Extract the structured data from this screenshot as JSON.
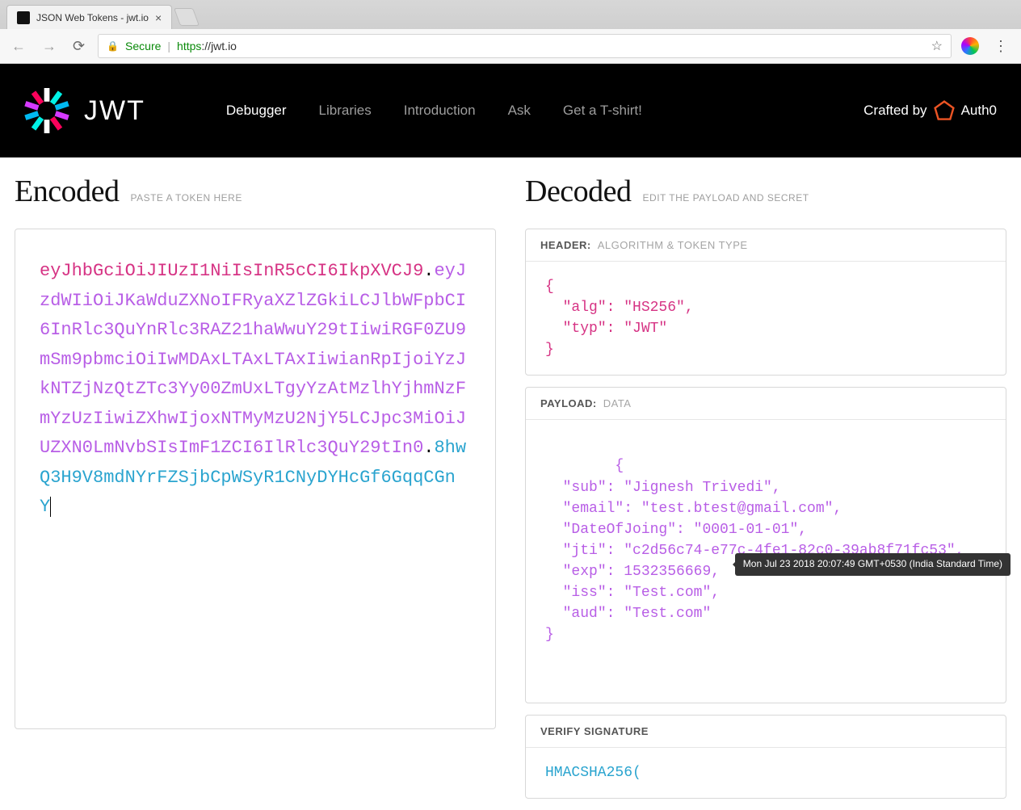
{
  "browser": {
    "tab_title": "JSON Web Tokens - jwt.io",
    "secure_label": "Secure",
    "url_scheme": "https",
    "url_host": "://jwt.io"
  },
  "header": {
    "brand": "JWT",
    "nav": {
      "debugger": "Debugger",
      "libraries": "Libraries",
      "introduction": "Introduction",
      "ask": "Ask",
      "tshirt": "Get a T-shirt!"
    },
    "crafted_by": "Crafted by",
    "auth0": "Auth0"
  },
  "encoded": {
    "title": "Encoded",
    "subtitle": "PASTE A TOKEN HERE",
    "token_header": "eyJhbGciOiJIUzI1NiIsInR5cCI6IkpXVCJ9",
    "token_payload": "eyJzdWIiOiJKaWduZXNoIFRyaXZlZGkiLCJlbWFpbCI6InRlc3QuYnRlc3RAZ21haWwuY29tIiwiRGF0ZU9mSm9pbmciOiIwMDAxLTAxLTAxIiwianRpIjoiYzJkNTZjNzQtZTc3Yy00ZmUxLTgyYzAtMzlhYjhmNzFmYzUzIiwiZXhwIjoxNTMyMzU2NjY5LCJpc3MiOiJUZXN0LmNvbSIsImF1ZCI6IlRlc3QuY29tIn0",
    "token_sig": "8hwQ3H9V8mdNYrFZSjbCpWSyR1CNyDYHcGf6GqqCGnY"
  },
  "decoded": {
    "title": "Decoded",
    "subtitle": "EDIT THE PAYLOAD AND SECRET",
    "header_section": {
      "label": "HEADER:",
      "sublabel": "ALGORITHM & TOKEN TYPE",
      "json": "{\n  \"alg\": \"HS256\",\n  \"typ\": \"JWT\"\n}"
    },
    "payload_section": {
      "label": "PAYLOAD:",
      "sublabel": "DATA",
      "json": "{\n  \"sub\": \"Jignesh Trivedi\",\n  \"email\": \"test.btest@gmail.com\",\n  \"DateOfJoing\": \"0001-01-01\",\n  \"jti\": \"c2d56c74-e77c-4fe1-82c0-39ab8f71fc53\",\n  \"exp\": 1532356669,\n  \"iss\": \"Test.com\",\n  \"aud\": \"Test.com\"\n}",
      "exp_tooltip": "Mon Jul 23 2018 20:07:49 GMT+0530 (India Standard Time)"
    },
    "signature_section": {
      "label": "VERIFY SIGNATURE",
      "body": "HMACSHA256("
    }
  }
}
